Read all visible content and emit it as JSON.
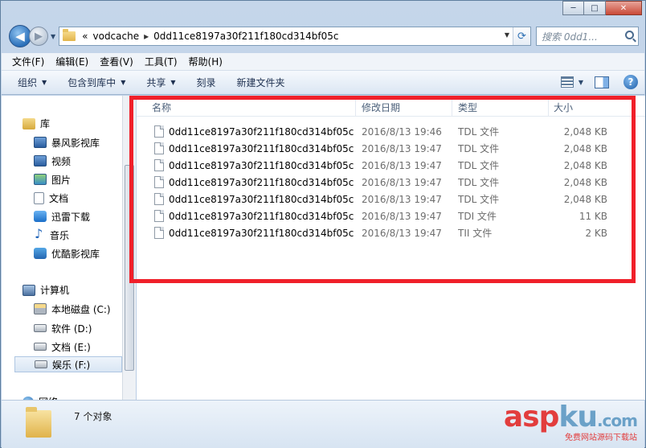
{
  "window": {
    "controls": {
      "minimize": "─",
      "maximize": "□",
      "close": "✕"
    }
  },
  "address_bar": {
    "prefix": "«",
    "crumbs": [
      "vodcache",
      "0dd11ce8197a30f211f180cd314bf05c"
    ],
    "separator": "▸",
    "search_placeholder": "搜索 0dd1..."
  },
  "menu": [
    "文件(F)",
    "编辑(E)",
    "查看(V)",
    "工具(T)",
    "帮助(H)"
  ],
  "commands": {
    "organize": "组织",
    "include_in_library": "包含到库中",
    "share": "共享",
    "burn": "刻录",
    "new_folder": "新建文件夹"
  },
  "nav_pane": {
    "libraries": "库",
    "library_items": [
      "暴风影视库",
      "视频",
      "图片",
      "文档",
      "迅雷下载",
      "音乐",
      "优酷影视库"
    ],
    "computer": "计算机",
    "drives": [
      "本地磁盘 (C:)",
      "软件 (D:)",
      "文档 (E:)",
      "娱乐 (F:)"
    ],
    "network": "网络"
  },
  "columns": {
    "name": "名称",
    "date": "修改日期",
    "type": "类型",
    "size": "大小"
  },
  "files": [
    {
      "name": "0dd11ce8197a30f211f180cd314bf05c...",
      "date": "2016/8/13 19:46",
      "type": "TDL 文件",
      "size": "2,048 KB"
    },
    {
      "name": "0dd11ce8197a30f211f180cd314bf05c...",
      "date": "2016/8/13 19:47",
      "type": "TDL 文件",
      "size": "2,048 KB"
    },
    {
      "name": "0dd11ce8197a30f211f180cd314bf05c...",
      "date": "2016/8/13 19:47",
      "type": "TDL 文件",
      "size": "2,048 KB"
    },
    {
      "name": "0dd11ce8197a30f211f180cd314bf05c...",
      "date": "2016/8/13 19:47",
      "type": "TDL 文件",
      "size": "2,048 KB"
    },
    {
      "name": "0dd11ce8197a30f211f180cd314bf05c...",
      "date": "2016/8/13 19:47",
      "type": "TDL 文件",
      "size": "2,048 KB"
    },
    {
      "name": "0dd11ce8197a30f211f180cd314bf05c...",
      "date": "2016/8/13 19:47",
      "type": "TDI 文件",
      "size": "11 KB"
    },
    {
      "name": "0dd11ce8197a30f211f180cd314bf05c...",
      "date": "2016/8/13 19:47",
      "type": "TII 文件",
      "size": "2 KB"
    }
  ],
  "status": {
    "count_text": "7 个对象"
  },
  "watermark": {
    "main_a": "asp",
    "main_b": "ku",
    "tld": ".com",
    "sub": "免费网站源码下载站"
  },
  "colors": {
    "highlight_box": "#f0202a"
  }
}
